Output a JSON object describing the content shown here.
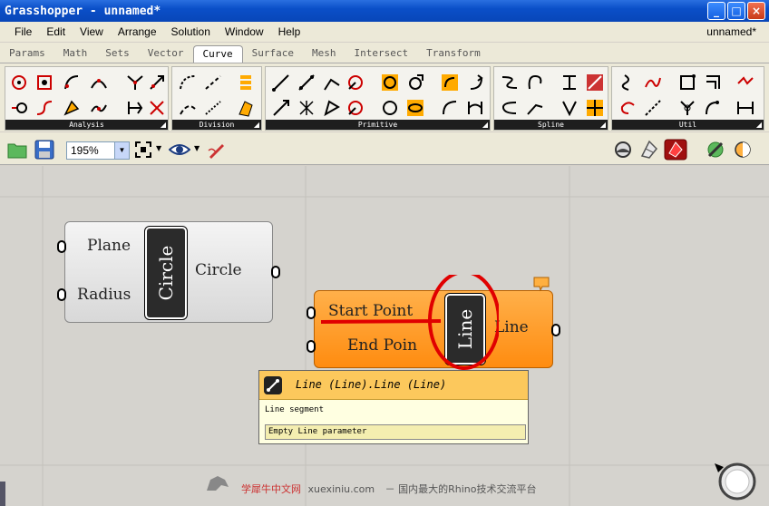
{
  "window": {
    "title": "Grasshopper - unnamed*",
    "doc_name": "unnamed*"
  },
  "menu": [
    "File",
    "Edit",
    "View",
    "Arrange",
    "Solution",
    "Window",
    "Help"
  ],
  "tabs": [
    "Params",
    "Math",
    "Sets",
    "Vector",
    "Curve",
    "Surface",
    "Mesh",
    "Intersect",
    "Transform"
  ],
  "active_tab": "Curve",
  "ribbon_groups": [
    "Analysis",
    "Division",
    "Primitive",
    "Spline",
    "Util"
  ],
  "zoom": {
    "value": "195%"
  },
  "circle_component": {
    "inputs": [
      "Plane",
      "Radius"
    ],
    "nickname": "Circle",
    "output": "Circle"
  },
  "line_component": {
    "inputs": [
      "Start Point",
      "End Poin"
    ],
    "nickname": "Line",
    "output": "Line"
  },
  "tooltip": {
    "title": "Line (Line).Line (Line)",
    "description": "Line segment",
    "status": "Empty Line parameter"
  },
  "watermark": {
    "site_cn": "学犀牛中文网",
    "site_en": "xuexiniu.com",
    "slogan": "－ 国内最大的Rhino技术交流平台"
  },
  "colors": {
    "component_orange": "#ff9a20",
    "tooltip_header": "#fcc85c",
    "annotation_red": "#e00000"
  }
}
